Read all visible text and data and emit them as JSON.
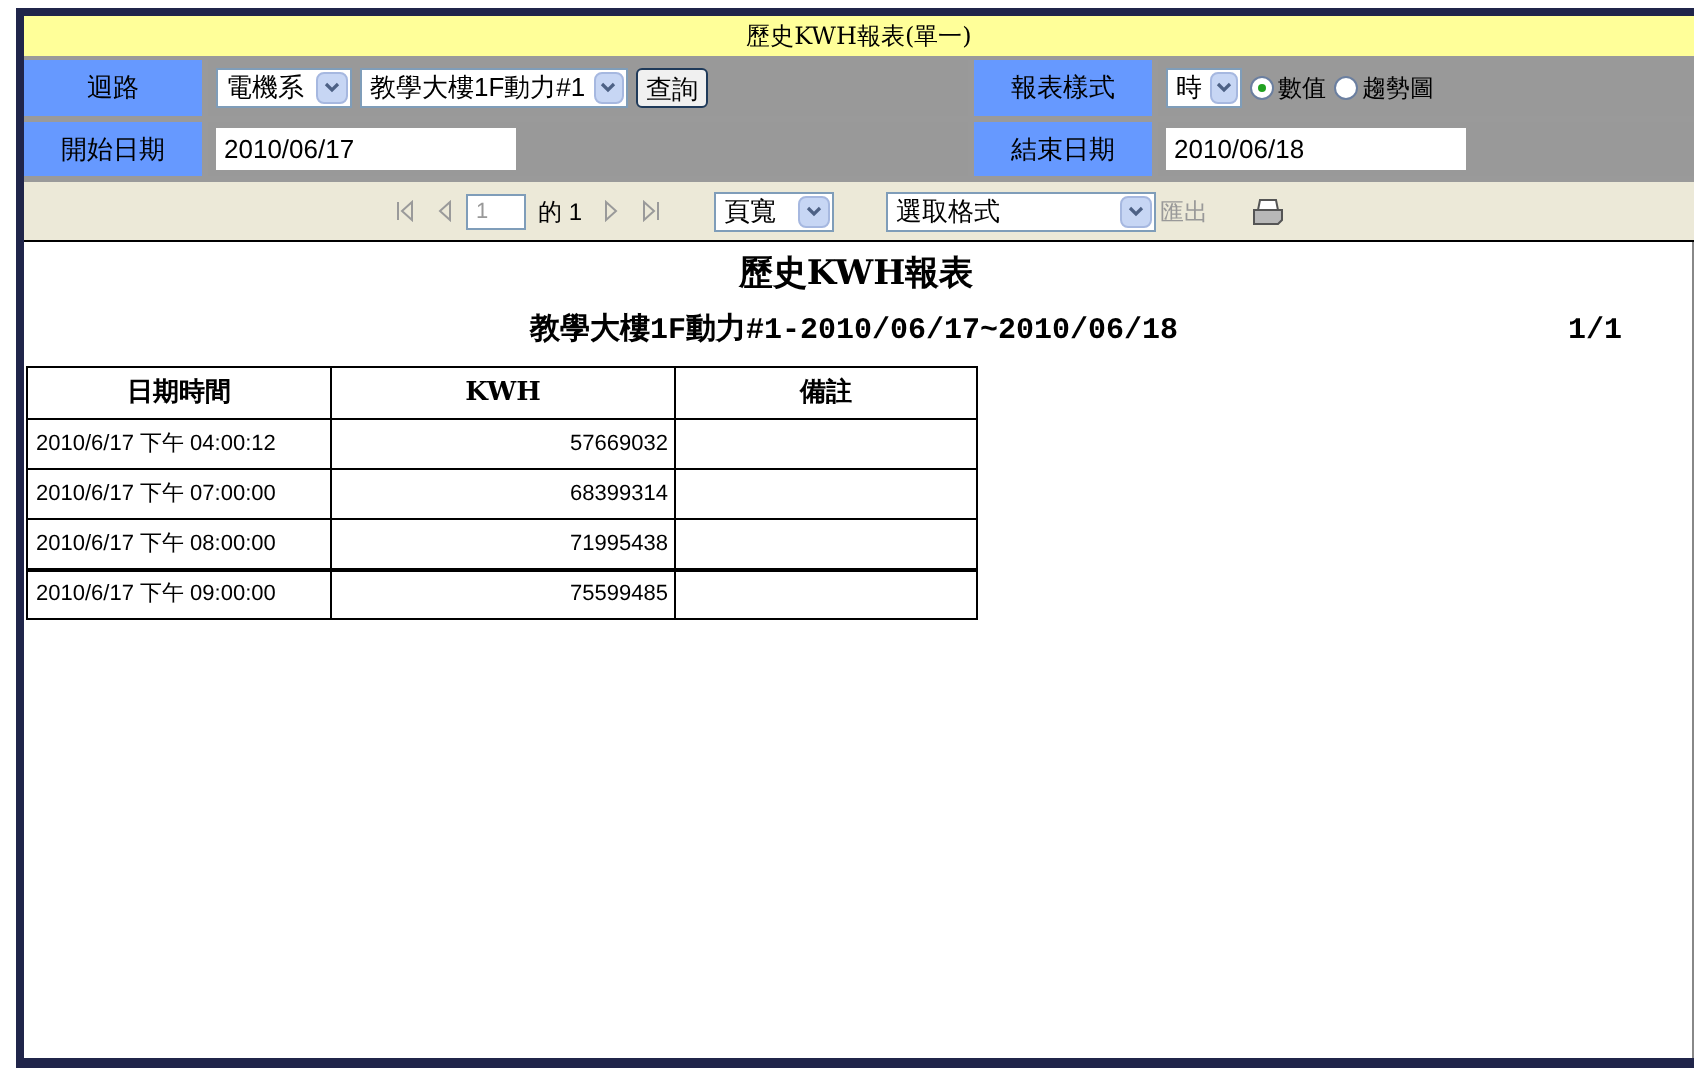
{
  "title": "歷史KWH報表(單一)",
  "filters": {
    "circuit": {
      "label": "迴路",
      "department": "電機系",
      "meter": "教學大樓1F動力#1",
      "button": "查詢"
    },
    "report_style": {
      "label": "報表樣式",
      "interval": "時",
      "radios": [
        {
          "label": "數值",
          "selected": true
        },
        {
          "label": "趨勢圖",
          "selected": false
        }
      ]
    },
    "start_date": {
      "label": "開始日期",
      "value": "2010/06/17"
    },
    "end_date": {
      "label": "結束日期",
      "value": "2010/06/18"
    }
  },
  "toolbar": {
    "page": "1",
    "page_count": "的 1",
    "zoom": "頁寬",
    "format": "選取格式",
    "export": {
      "label": "匯出",
      "disabled": true
    }
  },
  "report": {
    "title": "歷史KWH報表",
    "subtitle": "教學大樓1F動力#1-2010/06/17~2010/06/18",
    "page": "1/1",
    "columns": [
      "日期時間",
      "KWH",
      "備註"
    ],
    "rows": [
      {
        "datetime": "2010/6/17 下午 04:00:12",
        "kwh": "57669032"
      },
      {
        "datetime": "2010/6/17 下午 07:00:00",
        "kwh": "68399314"
      },
      {
        "datetime": "2010/6/17 下午 08:00:00",
        "kwh": "71995438"
      },
      {
        "datetime": "2010/6/17 下午 09:00:00",
        "kwh": "75599485"
      }
    ]
  }
}
